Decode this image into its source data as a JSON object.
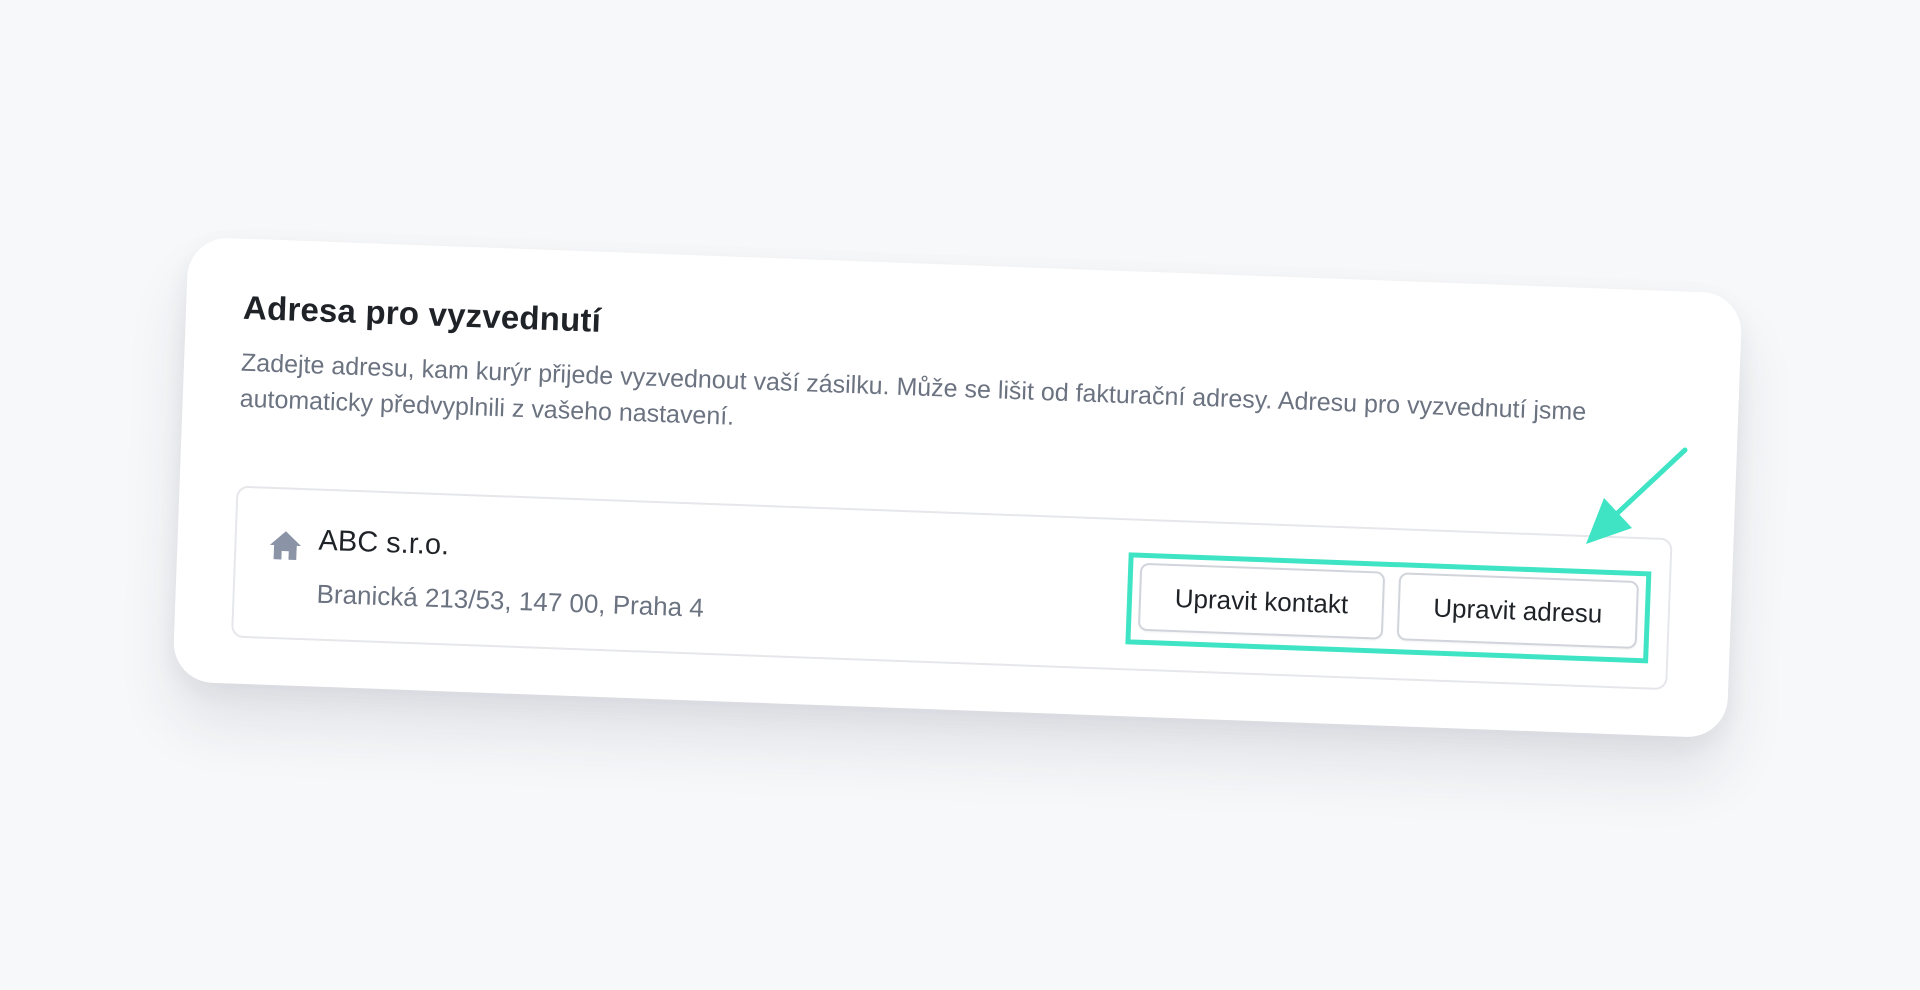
{
  "card": {
    "title": "Adresa pro vyzvednutí",
    "description": "Zadejte adresu, kam kurýr přijede vyzvednout vaší zásilku. Může se lišit od fakturační adresy. Adresu pro vyzvednutí jsme automaticky předvyplnili z vašeho nastavení."
  },
  "address": {
    "icon": "home-icon",
    "company": "ABC s.r.o.",
    "line": "Branická 213/53, 147 00, Praha 4"
  },
  "actions": {
    "edit_contact_label": "Upravit kontakt",
    "edit_address_label": "Upravit adresu"
  },
  "colors": {
    "highlight": "#3ee4c4",
    "text_primary": "#1f2328",
    "text_secondary": "#6b7280",
    "background": "#f7f8fa",
    "icon": "#8a94a6"
  }
}
